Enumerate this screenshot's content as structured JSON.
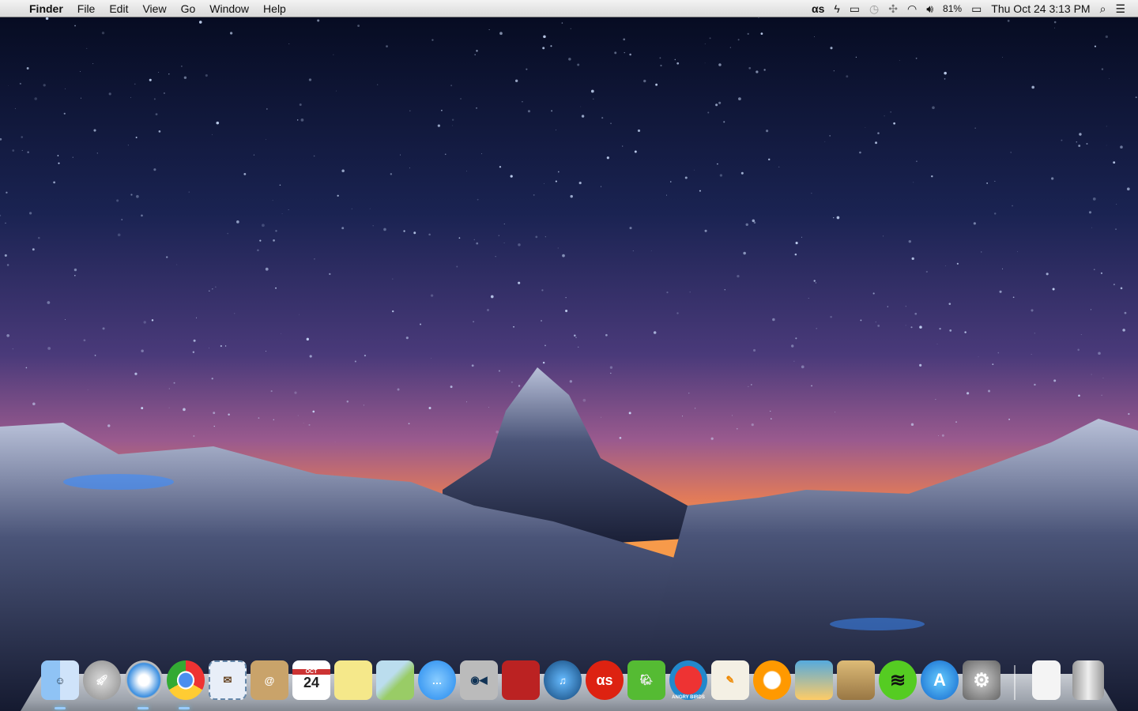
{
  "menubar": {
    "app_name": "Finder",
    "menus": [
      "File",
      "Edit",
      "View",
      "Go",
      "Window",
      "Help"
    ],
    "status": {
      "lastfm": "αs",
      "battery": "81%",
      "datetime": "Thu Oct 24  3:13 PM"
    }
  },
  "dock": {
    "calendar": {
      "month": "OCT",
      "day": "24"
    },
    "apps": [
      "Finder",
      "Launchpad",
      "Safari",
      "Google Chrome",
      "Mail",
      "Contacts",
      "Calendar",
      "Notes",
      "Maps",
      "Messages",
      "FaceTime",
      "Photo Booth",
      "iTunes",
      "Last.fm",
      "Evernote",
      "Angry Birds",
      "Pages",
      "iBooks",
      "iPhoto",
      "Aperture",
      "Spotify",
      "App Store",
      "System Preferences"
    ],
    "angry_birds_label": "ANGRY BIRDS"
  }
}
